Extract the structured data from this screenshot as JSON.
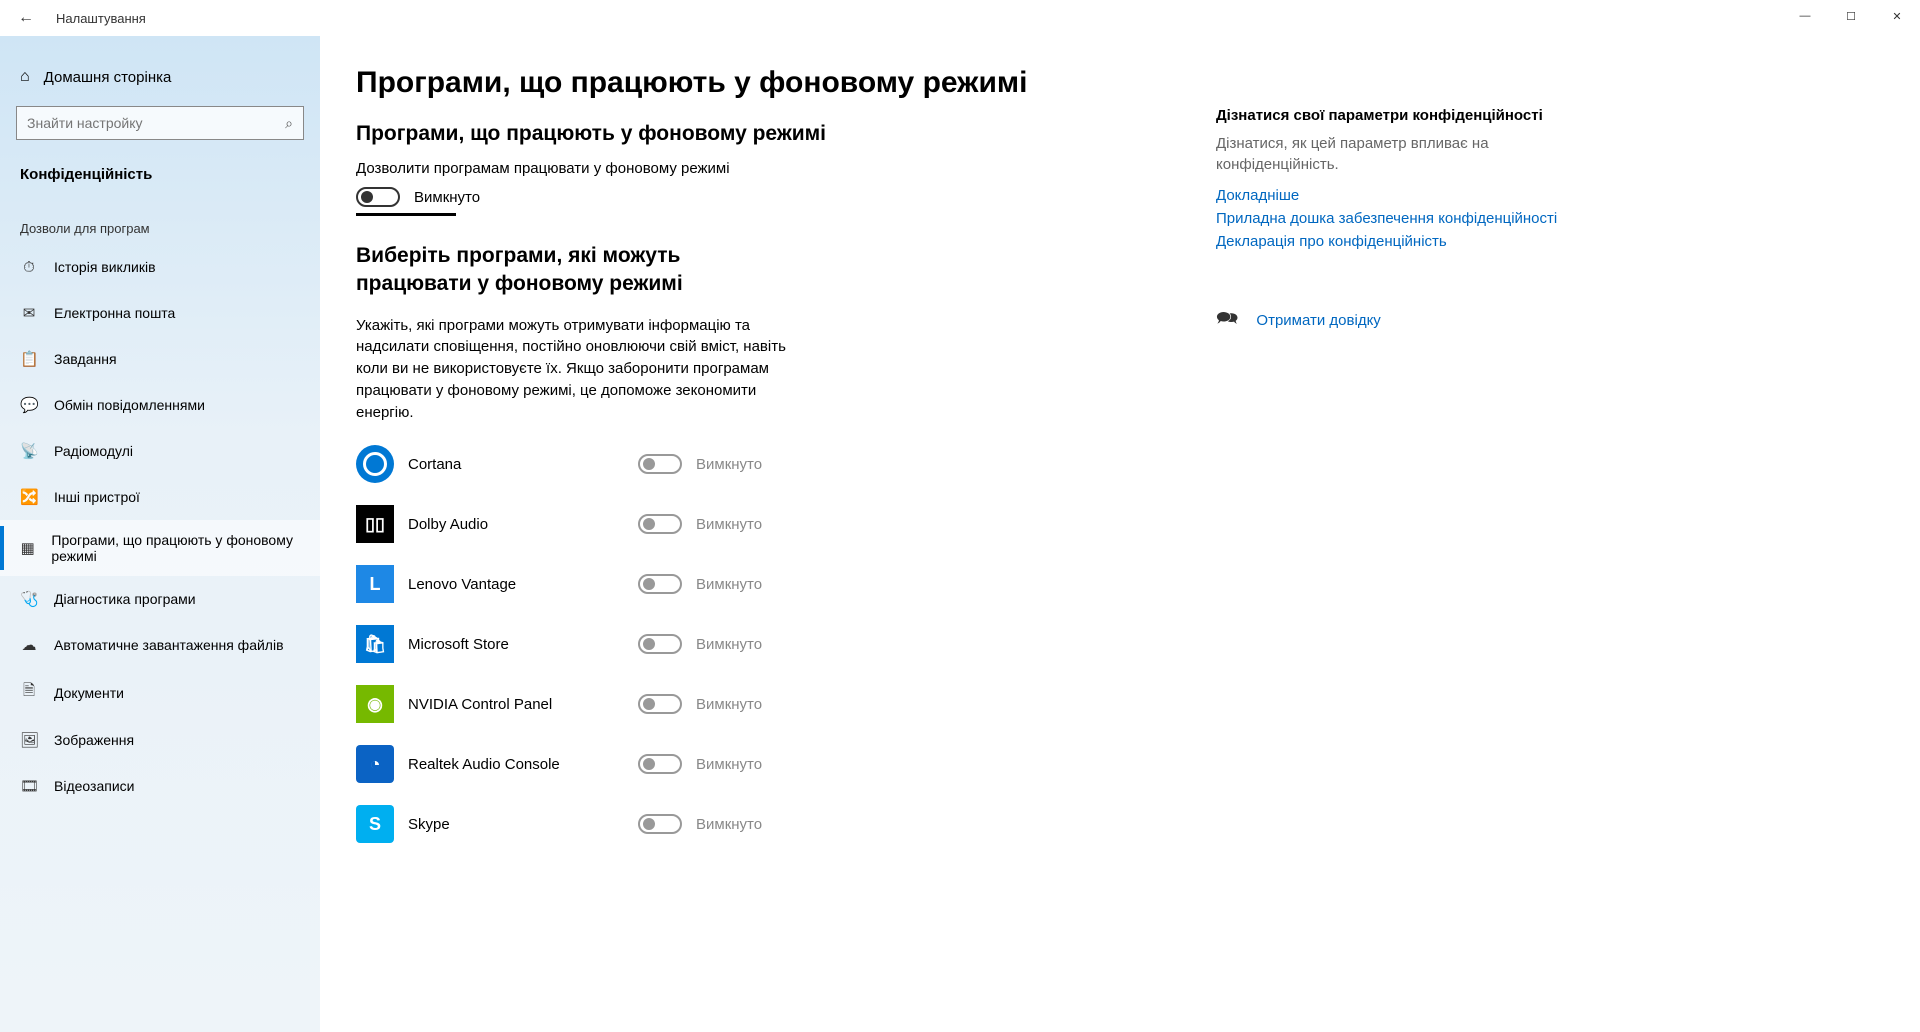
{
  "window": {
    "title": "Налаштування",
    "minimize": "—",
    "maximize": "☐",
    "close": "✕"
  },
  "sidebar": {
    "home": "Домашня сторінка",
    "search_placeholder": "Знайти настройку",
    "section": "Конфіденційність",
    "group": "Дозволи для програм",
    "items": [
      {
        "icon": "⏱",
        "label": "Історія викликів"
      },
      {
        "icon": "✉",
        "label": "Електронна пошта"
      },
      {
        "icon": "📋",
        "label": "Завдання"
      },
      {
        "icon": "💬",
        "label": "Обмін повідомленнями"
      },
      {
        "icon": "📡",
        "label": "Радіомодулі"
      },
      {
        "icon": "🔀",
        "label": "Інші пристрої"
      },
      {
        "icon": "▦",
        "label": "Програми, що працюють у фоновому режимі"
      },
      {
        "icon": "🩺",
        "label": "Діагностика програми"
      },
      {
        "icon": "☁",
        "label": "Автоматичне завантаження файлів"
      },
      {
        "icon": "🗎",
        "label": "Документи"
      },
      {
        "icon": "🖼",
        "label": "Зображення"
      },
      {
        "icon": "🎞",
        "label": "Відеозаписи"
      }
    ],
    "active_index": 6
  },
  "content": {
    "page_title": "Програми, що працюють у фоновому режимі",
    "master_section": "Програми, що працюють у фоновому режимі",
    "master_label": "Дозволити програмам працювати у фоновому режимі",
    "master_state": "Вимкнуто",
    "select_title": "Виберіть програми, які можуть працювати у фоновому режимі",
    "select_desc": "Укажіть, які програми можуть отримувати інформацію та надсилати сповіщення, постійно оновлюючи свій вміст, навіть коли ви не використовуєте їх. Якщо заборонити програмам працювати у фоновому режимі, це допоможе зекономити енергію.",
    "apps": [
      {
        "name": "Cortana",
        "state": "Вимкнуто",
        "iconClass": "ic-cortana",
        "glyph": ""
      },
      {
        "name": "Dolby Audio",
        "state": "Вимкнуто",
        "iconClass": "ic-dolby",
        "glyph": "▯▯"
      },
      {
        "name": "Lenovo Vantage",
        "state": "Вимкнуто",
        "iconClass": "ic-lenovo",
        "glyph": "L"
      },
      {
        "name": "Microsoft Store",
        "state": "Вимкнуто",
        "iconClass": "ic-store",
        "glyph": "🛍"
      },
      {
        "name": "NVIDIA Control Panel",
        "state": "Вимкнуто",
        "iconClass": "ic-nvidia",
        "glyph": "◉"
      },
      {
        "name": "Realtek Audio Console",
        "state": "Вимкнуто",
        "iconClass": "ic-realtek",
        "glyph": "◔"
      },
      {
        "name": "Skype",
        "state": "Вимкнуто",
        "iconClass": "ic-skype",
        "glyph": "S"
      }
    ]
  },
  "right": {
    "heading": "Дізнатися свої параметри конфіденційності",
    "desc": "Дізнатися, як цей параметр впливає на конфіденційність.",
    "links": [
      "Докладніше",
      "Приладна дошка забезпечення конфіденційності",
      "Декларація про конфіденційність"
    ],
    "help": "Отримати довідку"
  }
}
